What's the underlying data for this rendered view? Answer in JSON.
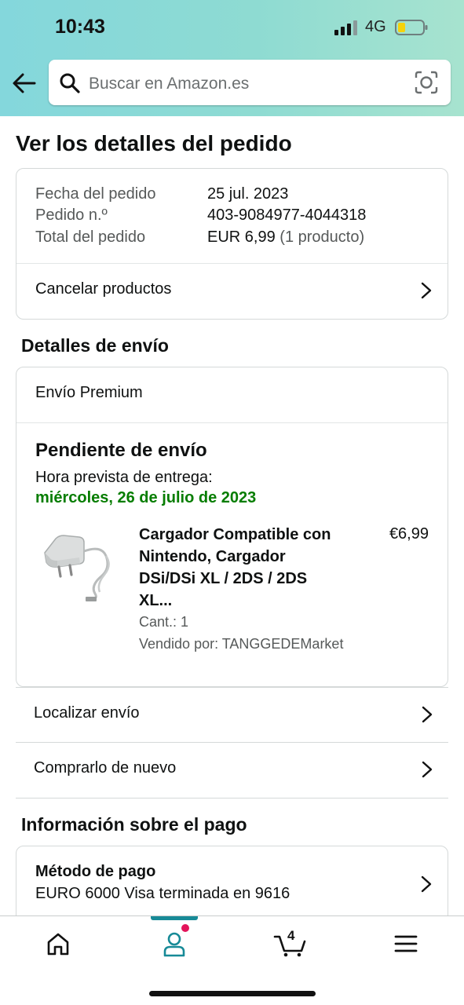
{
  "status_bar": {
    "time": "10:43",
    "network": "4G"
  },
  "search": {
    "placeholder": "Buscar en Amazon.es"
  },
  "page": {
    "title": "Ver los detalles del pedido"
  },
  "order_summary": {
    "fields": [
      {
        "label": "Fecha del pedido",
        "value": "25 jul. 2023"
      },
      {
        "label": "Pedido n.º",
        "value": "403-9084977-4044318"
      },
      {
        "label": "Total del pedido",
        "value": "EUR 6,99",
        "note": "(1 producto)"
      }
    ],
    "cancel_label": "Cancelar productos"
  },
  "shipping": {
    "section_title": "Detalles de envío",
    "method": "Envío Premium",
    "status": "Pendiente de envío",
    "eta_label": "Hora prevista de entrega:",
    "eta_date": "miércoles, 26 de julio de 2023",
    "item": {
      "title": "Cargador Compatible con Nintendo, Cargador DSi/DSi XL / 2DS / 2DS XL...",
      "price": "€6,99",
      "quantity": "Cant.: 1",
      "seller": "Vendido por: TANGGEDEMarket"
    }
  },
  "actions": {
    "track": "Localizar envío",
    "buy_again": "Comprarlo de nuevo"
  },
  "payment": {
    "section_title": "Información sobre el pago",
    "method_title": "Método de pago",
    "method_value": "EURO 6000 Visa terminada en 9616"
  },
  "tabbar": {
    "items": [
      "home-icon",
      "account-icon",
      "cart-icon",
      "menu-icon"
    ],
    "active": "account-icon",
    "cart_count": "4"
  },
  "colors": {
    "delivery_green": "#067d00",
    "tab_accent": "#178a97",
    "notification_dot": "#e3145a"
  }
}
